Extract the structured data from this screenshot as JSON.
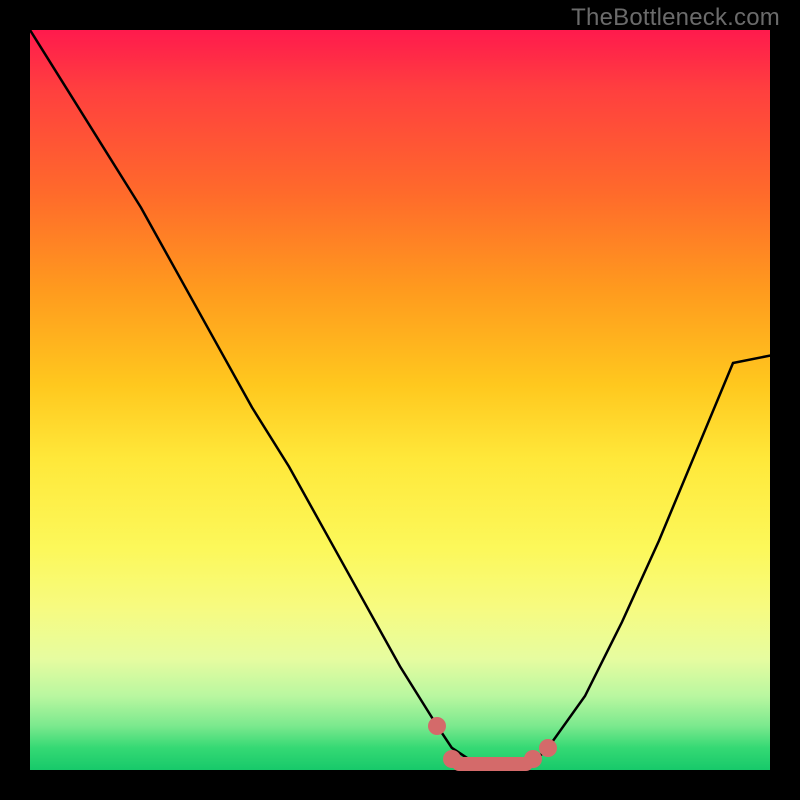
{
  "watermark": "TheBottleneck.com",
  "chart_data": {
    "type": "line",
    "title": "",
    "xlabel": "",
    "ylabel": "",
    "xlim": [
      0,
      100
    ],
    "ylim": [
      0,
      100
    ],
    "grid": false,
    "series": [
      {
        "name": "curve",
        "x": [
          0,
          5,
          10,
          15,
          20,
          25,
          30,
          35,
          40,
          45,
          50,
          55,
          57,
          60,
          63,
          65,
          68,
          70,
          75,
          80,
          85,
          90,
          95,
          100
        ],
        "values": [
          100,
          92,
          84,
          76,
          67,
          58,
          49,
          41,
          32,
          23,
          14,
          6,
          3,
          1,
          0,
          0,
          1,
          3,
          10,
          20,
          31,
          43,
          55,
          56
        ]
      }
    ],
    "markers": [
      {
        "name": "left-dot",
        "x": 55,
        "y": 6
      },
      {
        "name": "valley-start",
        "x": 57,
        "y": 1.5
      },
      {
        "name": "valley-end",
        "x": 68,
        "y": 1.5
      },
      {
        "name": "right-dot",
        "x": 70,
        "y": 3
      }
    ],
    "marker_bridge": {
      "x0": 57,
      "x1": 68,
      "y": 0.8
    },
    "background_gradient": {
      "stops": [
        {
          "pos": 0,
          "color": "#ff1a4d"
        },
        {
          "pos": 35,
          "color": "#ff9a1e"
        },
        {
          "pos": 60,
          "color": "#ffe83a"
        },
        {
          "pos": 85,
          "color": "#e6fca0"
        },
        {
          "pos": 100,
          "color": "#17c96a"
        }
      ]
    }
  }
}
